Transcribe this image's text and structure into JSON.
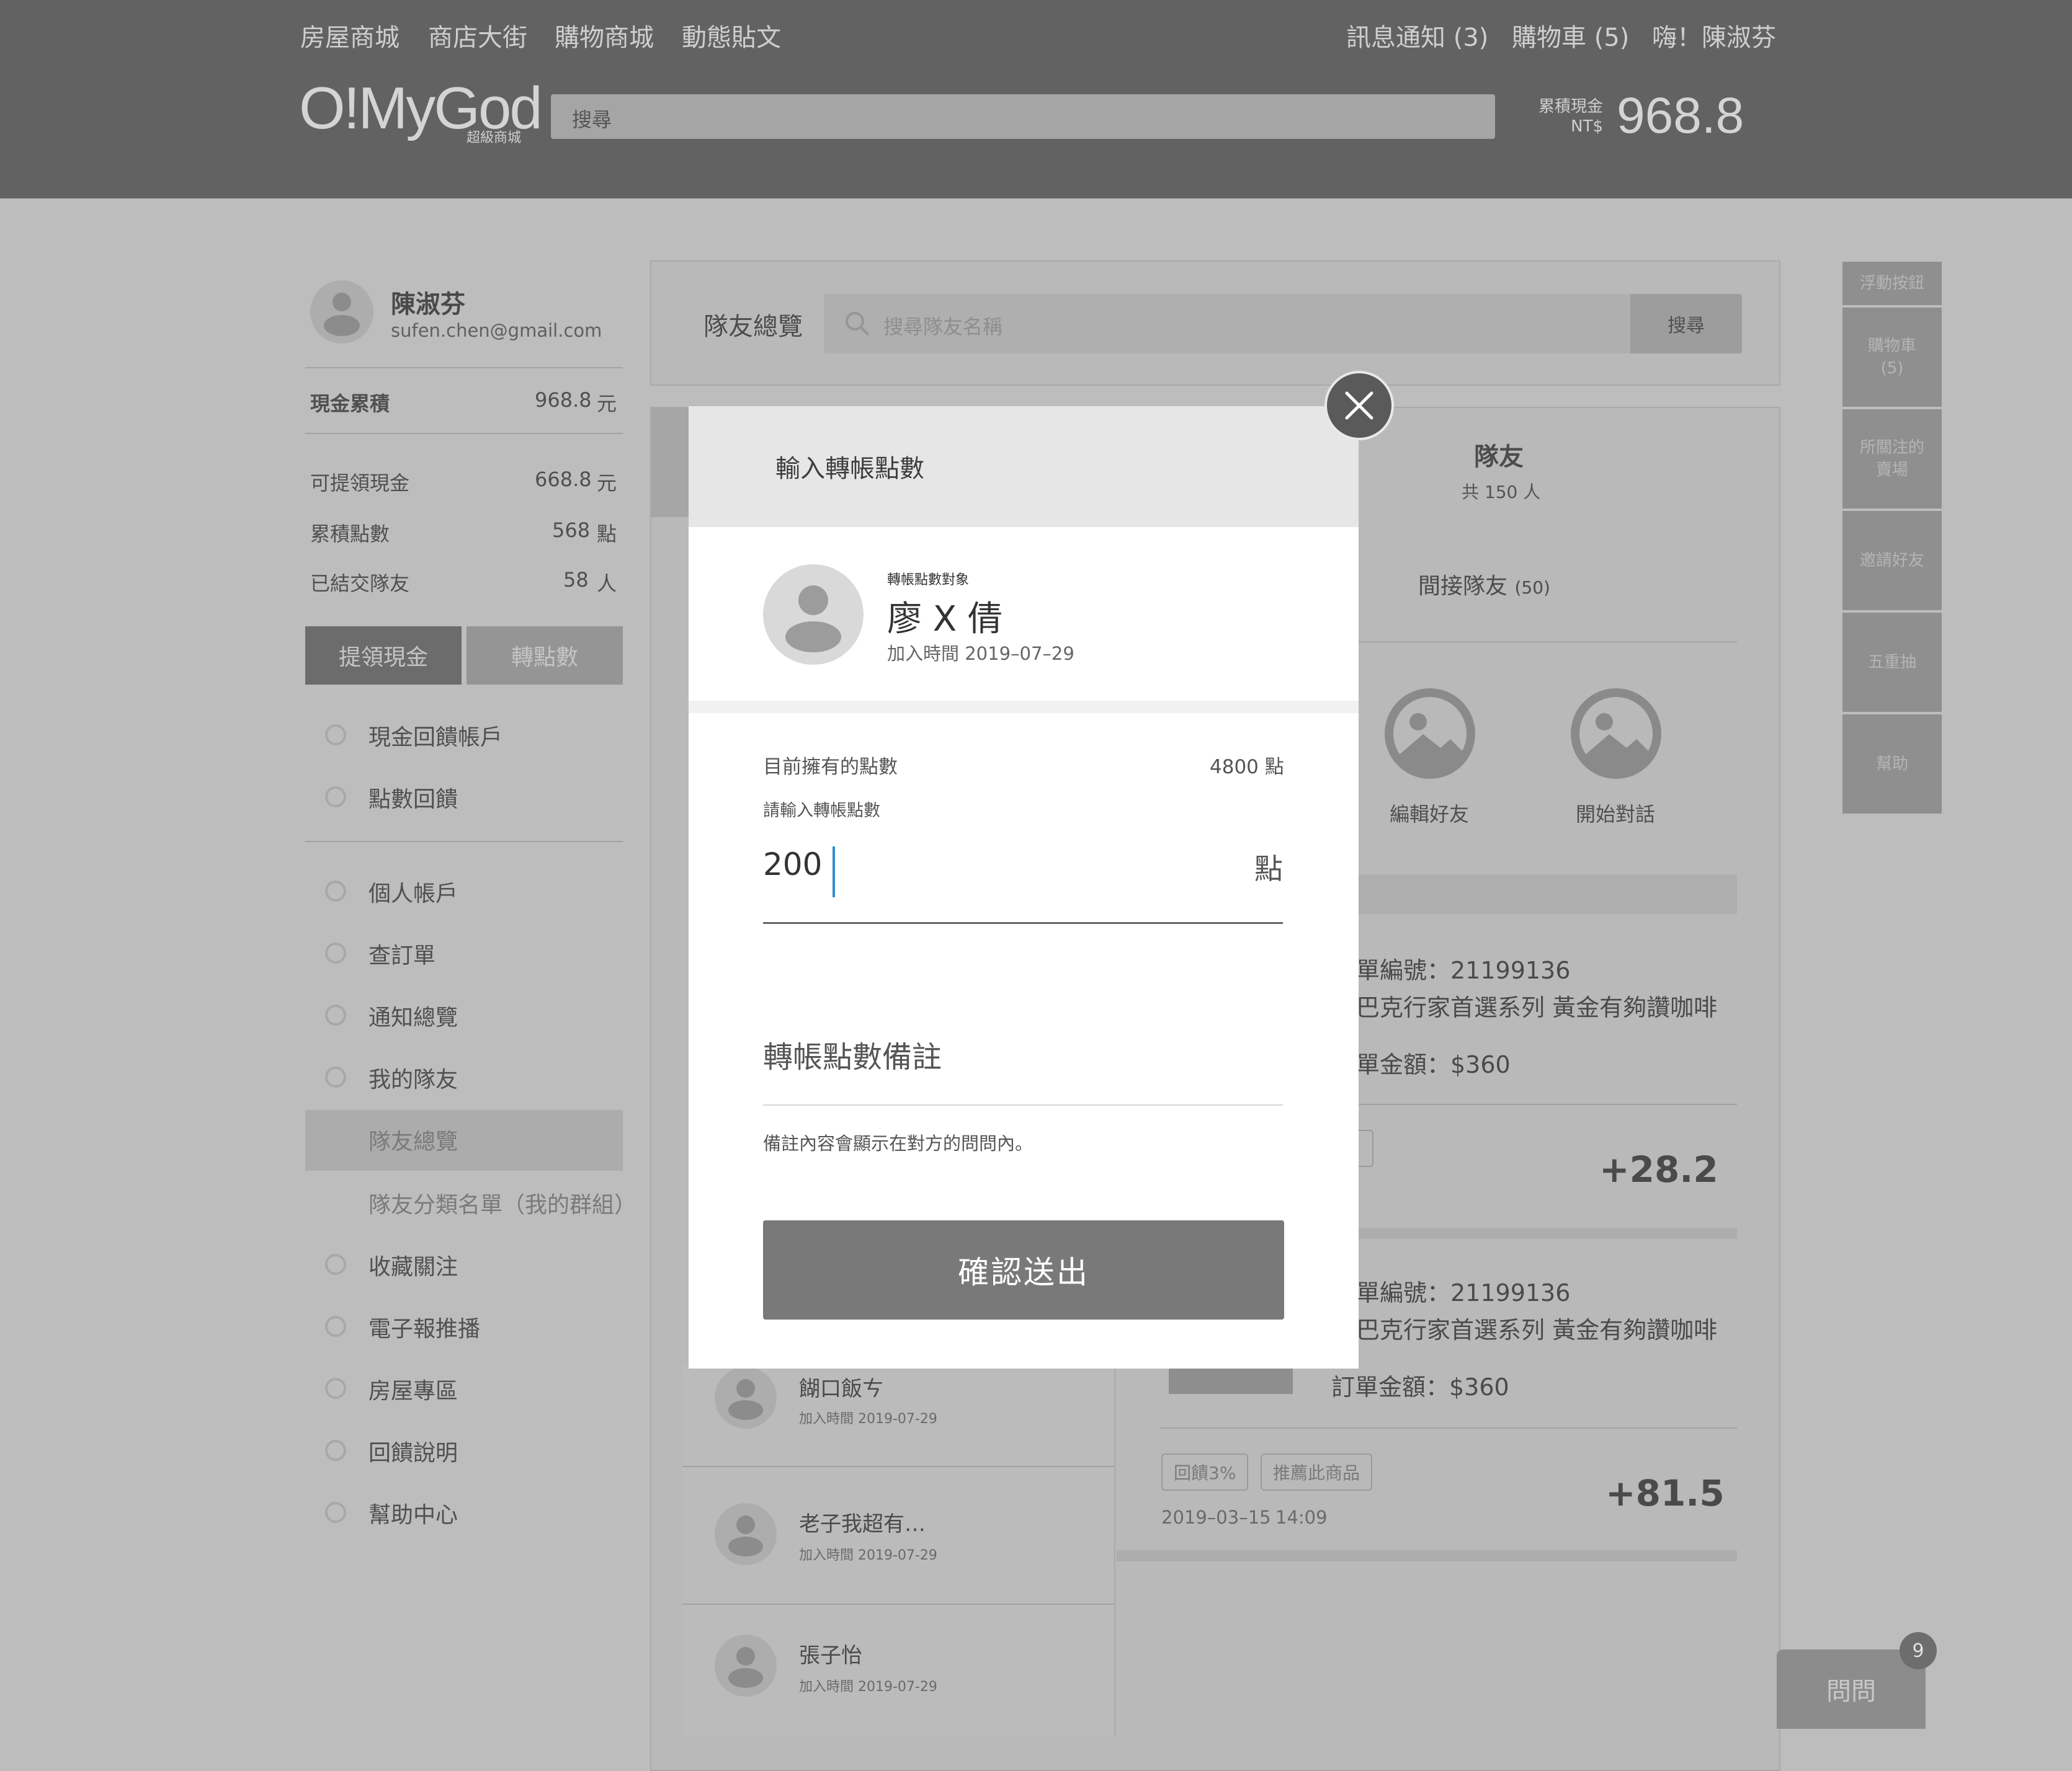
{
  "topbar": {
    "nav": [
      "房屋商城",
      "商店大街",
      "購物商城",
      "動態貼文"
    ],
    "notifications": "訊息通知 (3)",
    "cart": "購物車 (5)",
    "greeting": "嗨！陳淑芬",
    "logo": "O!MyGod",
    "logo_sub": "超級商城",
    "search_placeholder": "搜尋",
    "cash_label_1": "累積現金",
    "cash_label_2": "NT$",
    "cash_value": "968.8"
  },
  "profile": {
    "name": "陳淑芬",
    "email": "sufen.chen@gmail.com"
  },
  "stats": {
    "cash_total_label": "現金累積",
    "cash_total_value": "968.8",
    "cash_total_unit": "元",
    "withdrawable_label": "可提領現金",
    "withdrawable_value": "668.8",
    "withdrawable_unit": "元",
    "points_label": "累積點數",
    "points_value": "568",
    "points_unit": "點",
    "friends_label": "已結交隊友",
    "friends_value": "58",
    "friends_unit": "人"
  },
  "actions": {
    "withdraw": "提領現金",
    "transfer": "轉點數"
  },
  "menu": {
    "group1": [
      "現金回饋帳戶",
      "點數回饋"
    ],
    "group2": [
      "個人帳戶",
      "查訂單",
      "通知總覽",
      "我的隊友"
    ],
    "sub_active": "隊友總覽",
    "sub_other": "隊友分類名單（我的群組）",
    "group3": [
      "收藏關注",
      "電子報推播",
      "房屋專區",
      "回饋說明",
      "幫助中心"
    ]
  },
  "main": {
    "title": "隊友總覽",
    "search_placeholder": "搜尋隊友名稱",
    "search_button": "搜尋",
    "friends_title": "隊友",
    "friends_count": "共 150 人",
    "indirect_label": "間接隊友",
    "indirect_count": "(50)",
    "edit_friend": "編輯好友",
    "start_chat": "開始對話",
    "order_no": "單編號：21199136",
    "product": "巴克行家首選系列 黃金有夠讚咖啡",
    "order_amount_partial": "單金額：$360",
    "order_amount": "訂單金額：$360",
    "reward1": "+28.2",
    "reward2": "+81.5",
    "tag_rebate": "回饋3%",
    "tag_recommend": "推薦此商品",
    "date": "2019–03–15",
    "time": "14:09"
  },
  "friends_list": [
    {
      "name": "餬口飯ㄘ",
      "joined": "加入時間 2019-07-29"
    },
    {
      "name": "老子我超有…",
      "joined": "加入時間 2019-07-29"
    },
    {
      "name": "張子怡",
      "joined": "加入時間 2019-07-29"
    }
  ],
  "float_menu": [
    "浮動按鈕",
    "購物車\n(5)",
    "所關注的\n賣場",
    "邀請好友",
    "五重抽",
    "幫助"
  ],
  "chat": {
    "label": "問問",
    "badge": "9"
  },
  "modal": {
    "title": "輸入轉帳點數",
    "target_label": "轉帳點數對象",
    "target_name": "廖 X 倩",
    "target_joined": "加入時間 2019–07–29",
    "owned_label": "目前擁有的點數",
    "owned_value": "4800 點",
    "input_label": "請輸入轉帳點數",
    "input_value": "200",
    "input_unit": "點",
    "note_placeholder": "轉帳點數備註",
    "note_hint": "備註內容會顯示在對方的問問內。",
    "confirm": "確認送出"
  }
}
